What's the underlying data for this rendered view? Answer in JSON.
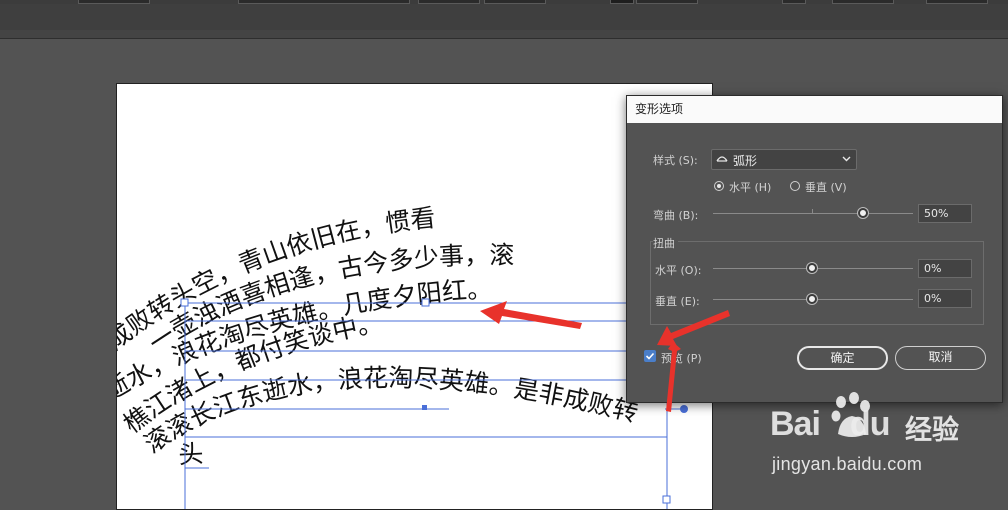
{
  "dialog": {
    "title": "变形选项",
    "style_label": "样式 (S):",
    "style_value": "弧形",
    "orientation": {
      "horizontal_label": "水平 (H)",
      "vertical_label": "垂直 (V)",
      "selected": "horizontal"
    },
    "bend_label": "弯曲 (B):",
    "bend_value": "50%",
    "bend_fraction": 0.75,
    "distortion_group_label": "扭曲",
    "horizontal_distort_label": "水平 (O):",
    "horizontal_distort_value": "0%",
    "vertical_distort_label": "垂直 (E):",
    "vertical_distort_value": "0%",
    "preview_label": "预览 (P)",
    "preview_checked": true,
    "ok_label": "确定",
    "cancel_label": "取消"
  },
  "artboard_text": {
    "line1": "是非成败转头空，青山依旧在，惯看",
    "line2": "一壶浊酒喜相逢，古今多少事，滚",
    "line3": "。逝水，浪花淘尽英雄。几度夕阳红。",
    "line4": "樵江渚上，都付笑谈中。",
    "line5": "滚滚长江东逝水，浪花淘尽英雄。是非成败转",
    "line6": "头"
  },
  "watermark": {
    "logo": "Bai",
    "logo_suffix": "du",
    "chinese": "经验",
    "url": "jingyan.baidu.com"
  },
  "colors": {
    "panel": "#535353",
    "selection": "#4a6fd8",
    "arrow": "#e8322b",
    "checkbox": "#4a7ec9"
  }
}
